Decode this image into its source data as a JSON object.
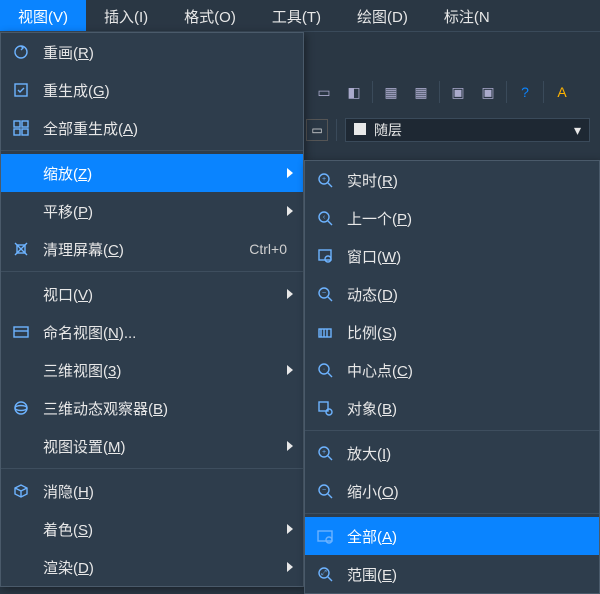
{
  "menubar": {
    "items": [
      {
        "label": "视图(V)",
        "active": true
      },
      {
        "label": "插入(I)"
      },
      {
        "label": "格式(O)"
      },
      {
        "label": "工具(T)"
      },
      {
        "label": "绘图(D)"
      },
      {
        "label": "标注(N"
      }
    ]
  },
  "layer": {
    "selected": "随层"
  },
  "viewMenu": {
    "items": [
      {
        "icon": "redraw-icon",
        "label": "重画(R)",
        "u": "R"
      },
      {
        "icon": "regen-icon",
        "label": "重生成(G)",
        "u": "G"
      },
      {
        "icon": "regen-all-icon",
        "label": "全部重生成(A)",
        "u": "A"
      },
      {
        "sep": true
      },
      {
        "icon": "",
        "label": "缩放(Z)",
        "u": "Z",
        "submenu": true,
        "highlight": true
      },
      {
        "icon": "",
        "label": "平移(P)",
        "u": "P",
        "submenu": true
      },
      {
        "icon": "clean-screen-icon",
        "label": "清理屏幕(C)",
        "u": "C",
        "shortcut": "Ctrl+0"
      },
      {
        "sep": true
      },
      {
        "icon": "",
        "label": "视口(V)",
        "u": "V",
        "submenu": true
      },
      {
        "icon": "named-views-icon",
        "label": "命名视图(N)...",
        "u": "N"
      },
      {
        "icon": "",
        "label": "三维视图(3)",
        "u": "3",
        "submenu": true
      },
      {
        "icon": "orbit-icon",
        "label": "三维动态观察器(B)",
        "u": "B"
      },
      {
        "icon": "",
        "label": "视图设置(M)",
        "u": "M",
        "submenu": true
      },
      {
        "sep": true
      },
      {
        "icon": "hide-icon",
        "label": "消隐(H)",
        "u": "H"
      },
      {
        "icon": "",
        "label": "着色(S)",
        "u": "S",
        "submenu": true
      },
      {
        "icon": "",
        "label": "渲染(D)",
        "u": "D",
        "submenu": true
      }
    ]
  },
  "zoomSubmenu": {
    "items": [
      {
        "icon": "zoom-rt-icon",
        "label": "实时(R)",
        "u": "R"
      },
      {
        "icon": "zoom-prev-icon",
        "label": "上一个(P)",
        "u": "P"
      },
      {
        "icon": "zoom-window-icon",
        "label": "窗口(W)",
        "u": "W"
      },
      {
        "icon": "zoom-dynamic-icon",
        "label": "动态(D)",
        "u": "D"
      },
      {
        "icon": "zoom-scale-icon",
        "label": "比例(S)",
        "u": "S"
      },
      {
        "icon": "zoom-center-icon",
        "label": "中心点(C)",
        "u": "C"
      },
      {
        "icon": "zoom-object-icon",
        "label": "对象(B)",
        "u": "B"
      },
      {
        "sep": true
      },
      {
        "icon": "zoom-in-icon",
        "label": "放大(I)",
        "u": "I"
      },
      {
        "icon": "zoom-out-icon",
        "label": "缩小(O)",
        "u": "O"
      },
      {
        "sep": true
      },
      {
        "icon": "zoom-all-icon",
        "label": "全部(A)",
        "u": "A",
        "highlight": true
      },
      {
        "icon": "zoom-extents-icon",
        "label": "范围(E)",
        "u": "E"
      }
    ]
  }
}
